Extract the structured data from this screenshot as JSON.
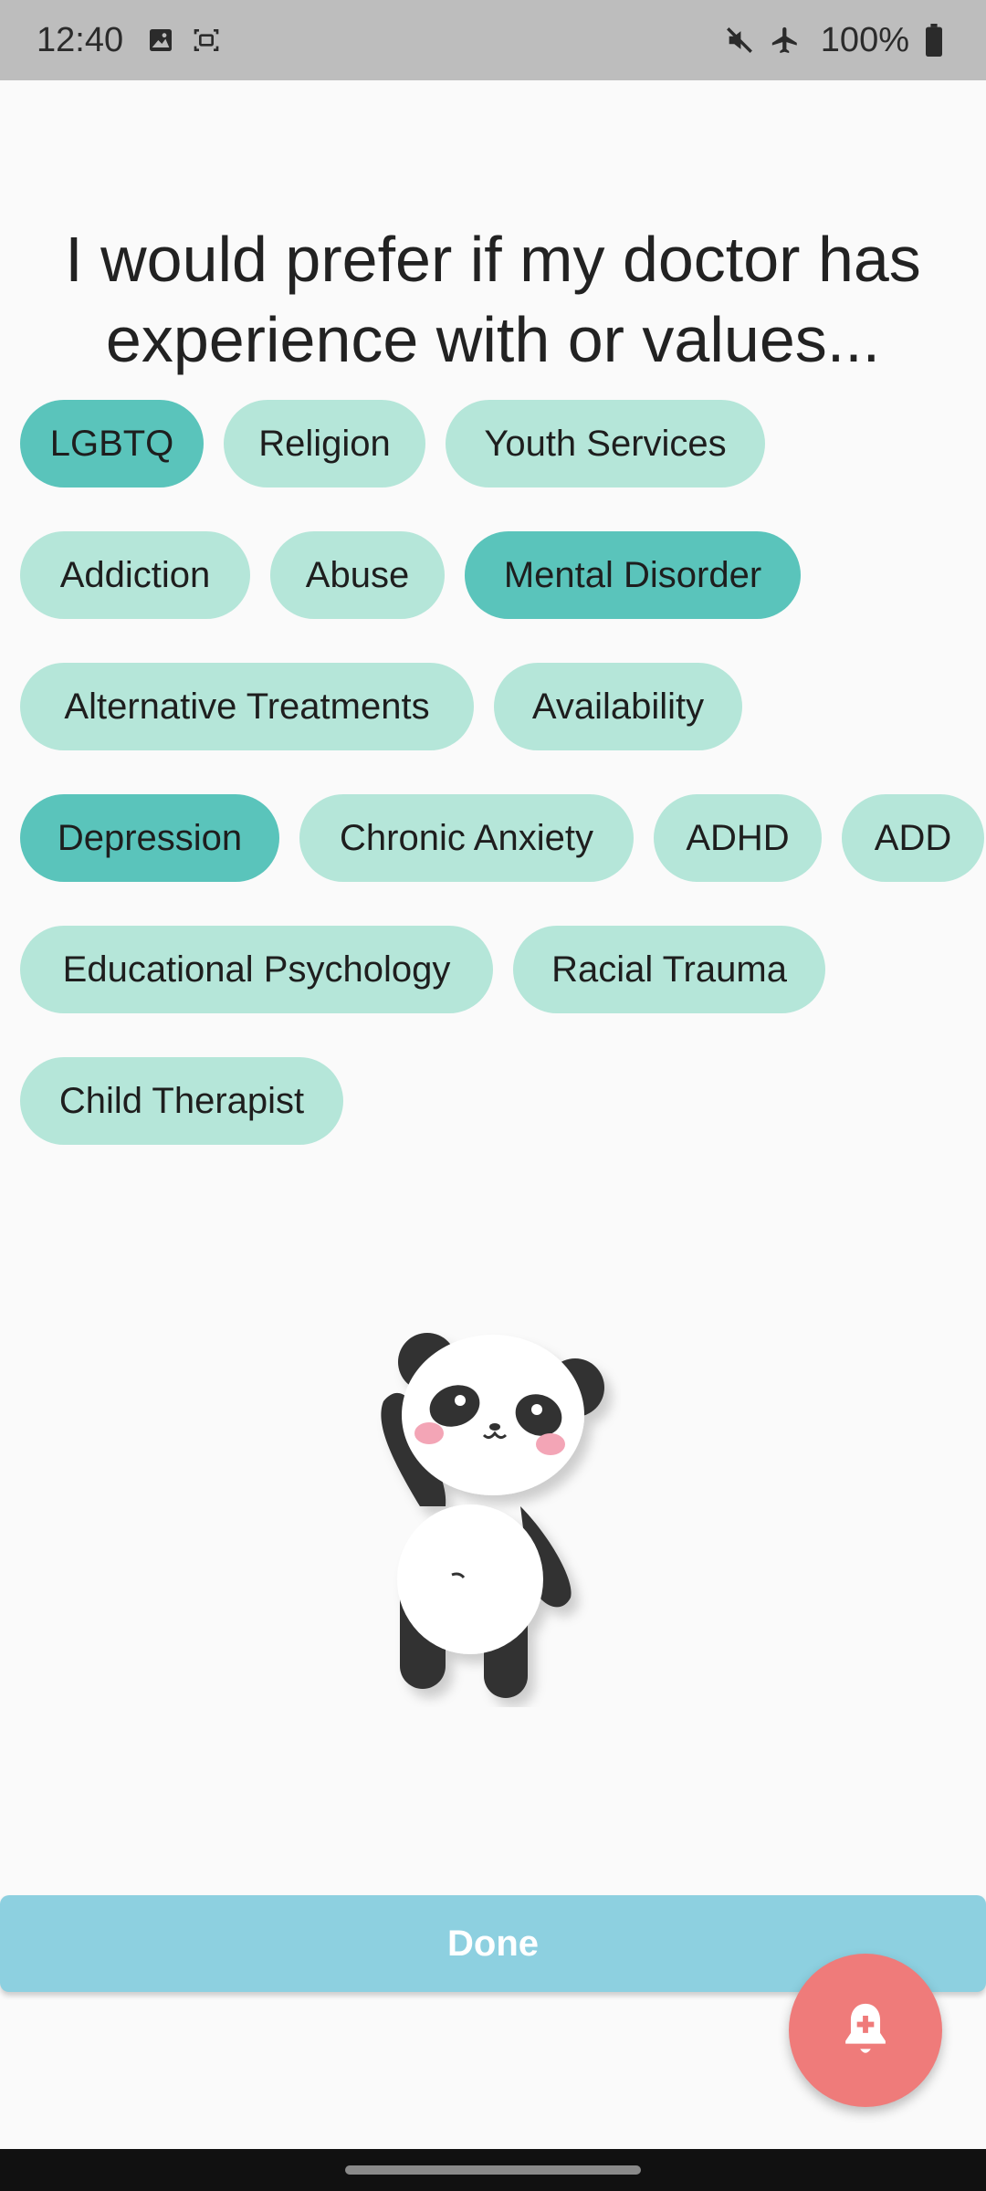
{
  "status_bar": {
    "time": "12:40",
    "battery": "100%",
    "icons": [
      "image-icon",
      "screenshot-icon",
      "mute-icon",
      "airplane-icon",
      "battery-icon"
    ]
  },
  "heading": "I would prefer if my doctor has experience with or values...",
  "chips": [
    {
      "label": "LGBTQ",
      "selected": true
    },
    {
      "label": "Religion",
      "selected": false
    },
    {
      "label": "Youth Services",
      "selected": false
    },
    {
      "label": "Addiction",
      "selected": false
    },
    {
      "label": "Abuse",
      "selected": false
    },
    {
      "label": "Mental Disorder",
      "selected": true
    },
    {
      "label": "Alternative Treatments",
      "selected": false
    },
    {
      "label": "Availability",
      "selected": false
    },
    {
      "label": "Depression",
      "selected": true
    },
    {
      "label": "Chronic Anxiety",
      "selected": false
    },
    {
      "label": "ADHD",
      "selected": false
    },
    {
      "label": "ADD",
      "selected": false
    },
    {
      "label": "Educational Psychology",
      "selected": false
    },
    {
      "label": "Racial Trauma",
      "selected": false
    },
    {
      "label": "Child Therapist",
      "selected": false
    }
  ],
  "done_label": "Done",
  "fab_icon": "add-alert-icon",
  "colors": {
    "chip": "#b5e6d9",
    "chip_selected": "#5ac4bb",
    "done": "#8dd0e0",
    "fab": "#ef7b7a"
  }
}
